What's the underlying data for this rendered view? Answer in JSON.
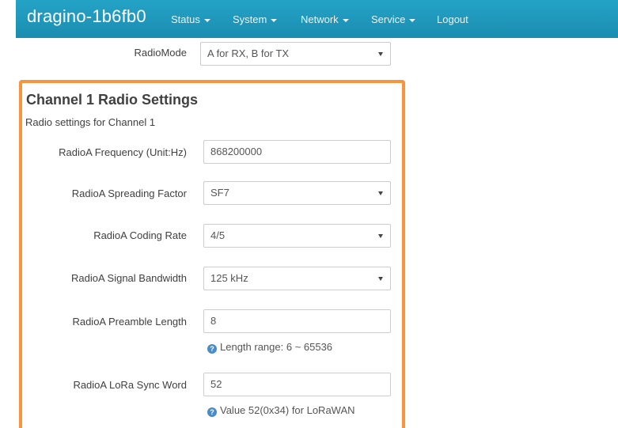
{
  "navbar": {
    "brand": "dragino-1b6fb0",
    "menu": [
      "Status",
      "System",
      "Network",
      "Service"
    ],
    "logout": "Logout"
  },
  "radio_mode": {
    "label": "RadioMode",
    "value": "A for RX, B for TX"
  },
  "section": {
    "title": "Channel 1 Radio Settings",
    "description": "Radio settings for Channel 1"
  },
  "fields": {
    "frequency": {
      "label": "RadioA Frequency (Unit:Hz)",
      "value": "868200000"
    },
    "spreading_factor": {
      "label": "RadioA Spreading Factor",
      "value": "SF7"
    },
    "coding_rate": {
      "label": "RadioA Coding Rate",
      "value": "4/5"
    },
    "bandwidth": {
      "label": "RadioA Signal Bandwidth",
      "value": "125 kHz"
    },
    "preamble": {
      "label": "RadioA Preamble Length",
      "value": "8",
      "hint": "Length range: 6 ~ 65536"
    },
    "sync_word": {
      "label": "RadioA LoRa Sync Word",
      "value": "52",
      "hint": "Value 52(0x34) for LoRaWAN"
    }
  },
  "colors": {
    "navbar": "#1e96b8",
    "highlight": "#f7943d",
    "help_icon": "#4a8cc7"
  },
  "icons": {
    "help": "question-circle-icon",
    "dropdown": "caret-down-icon"
  }
}
